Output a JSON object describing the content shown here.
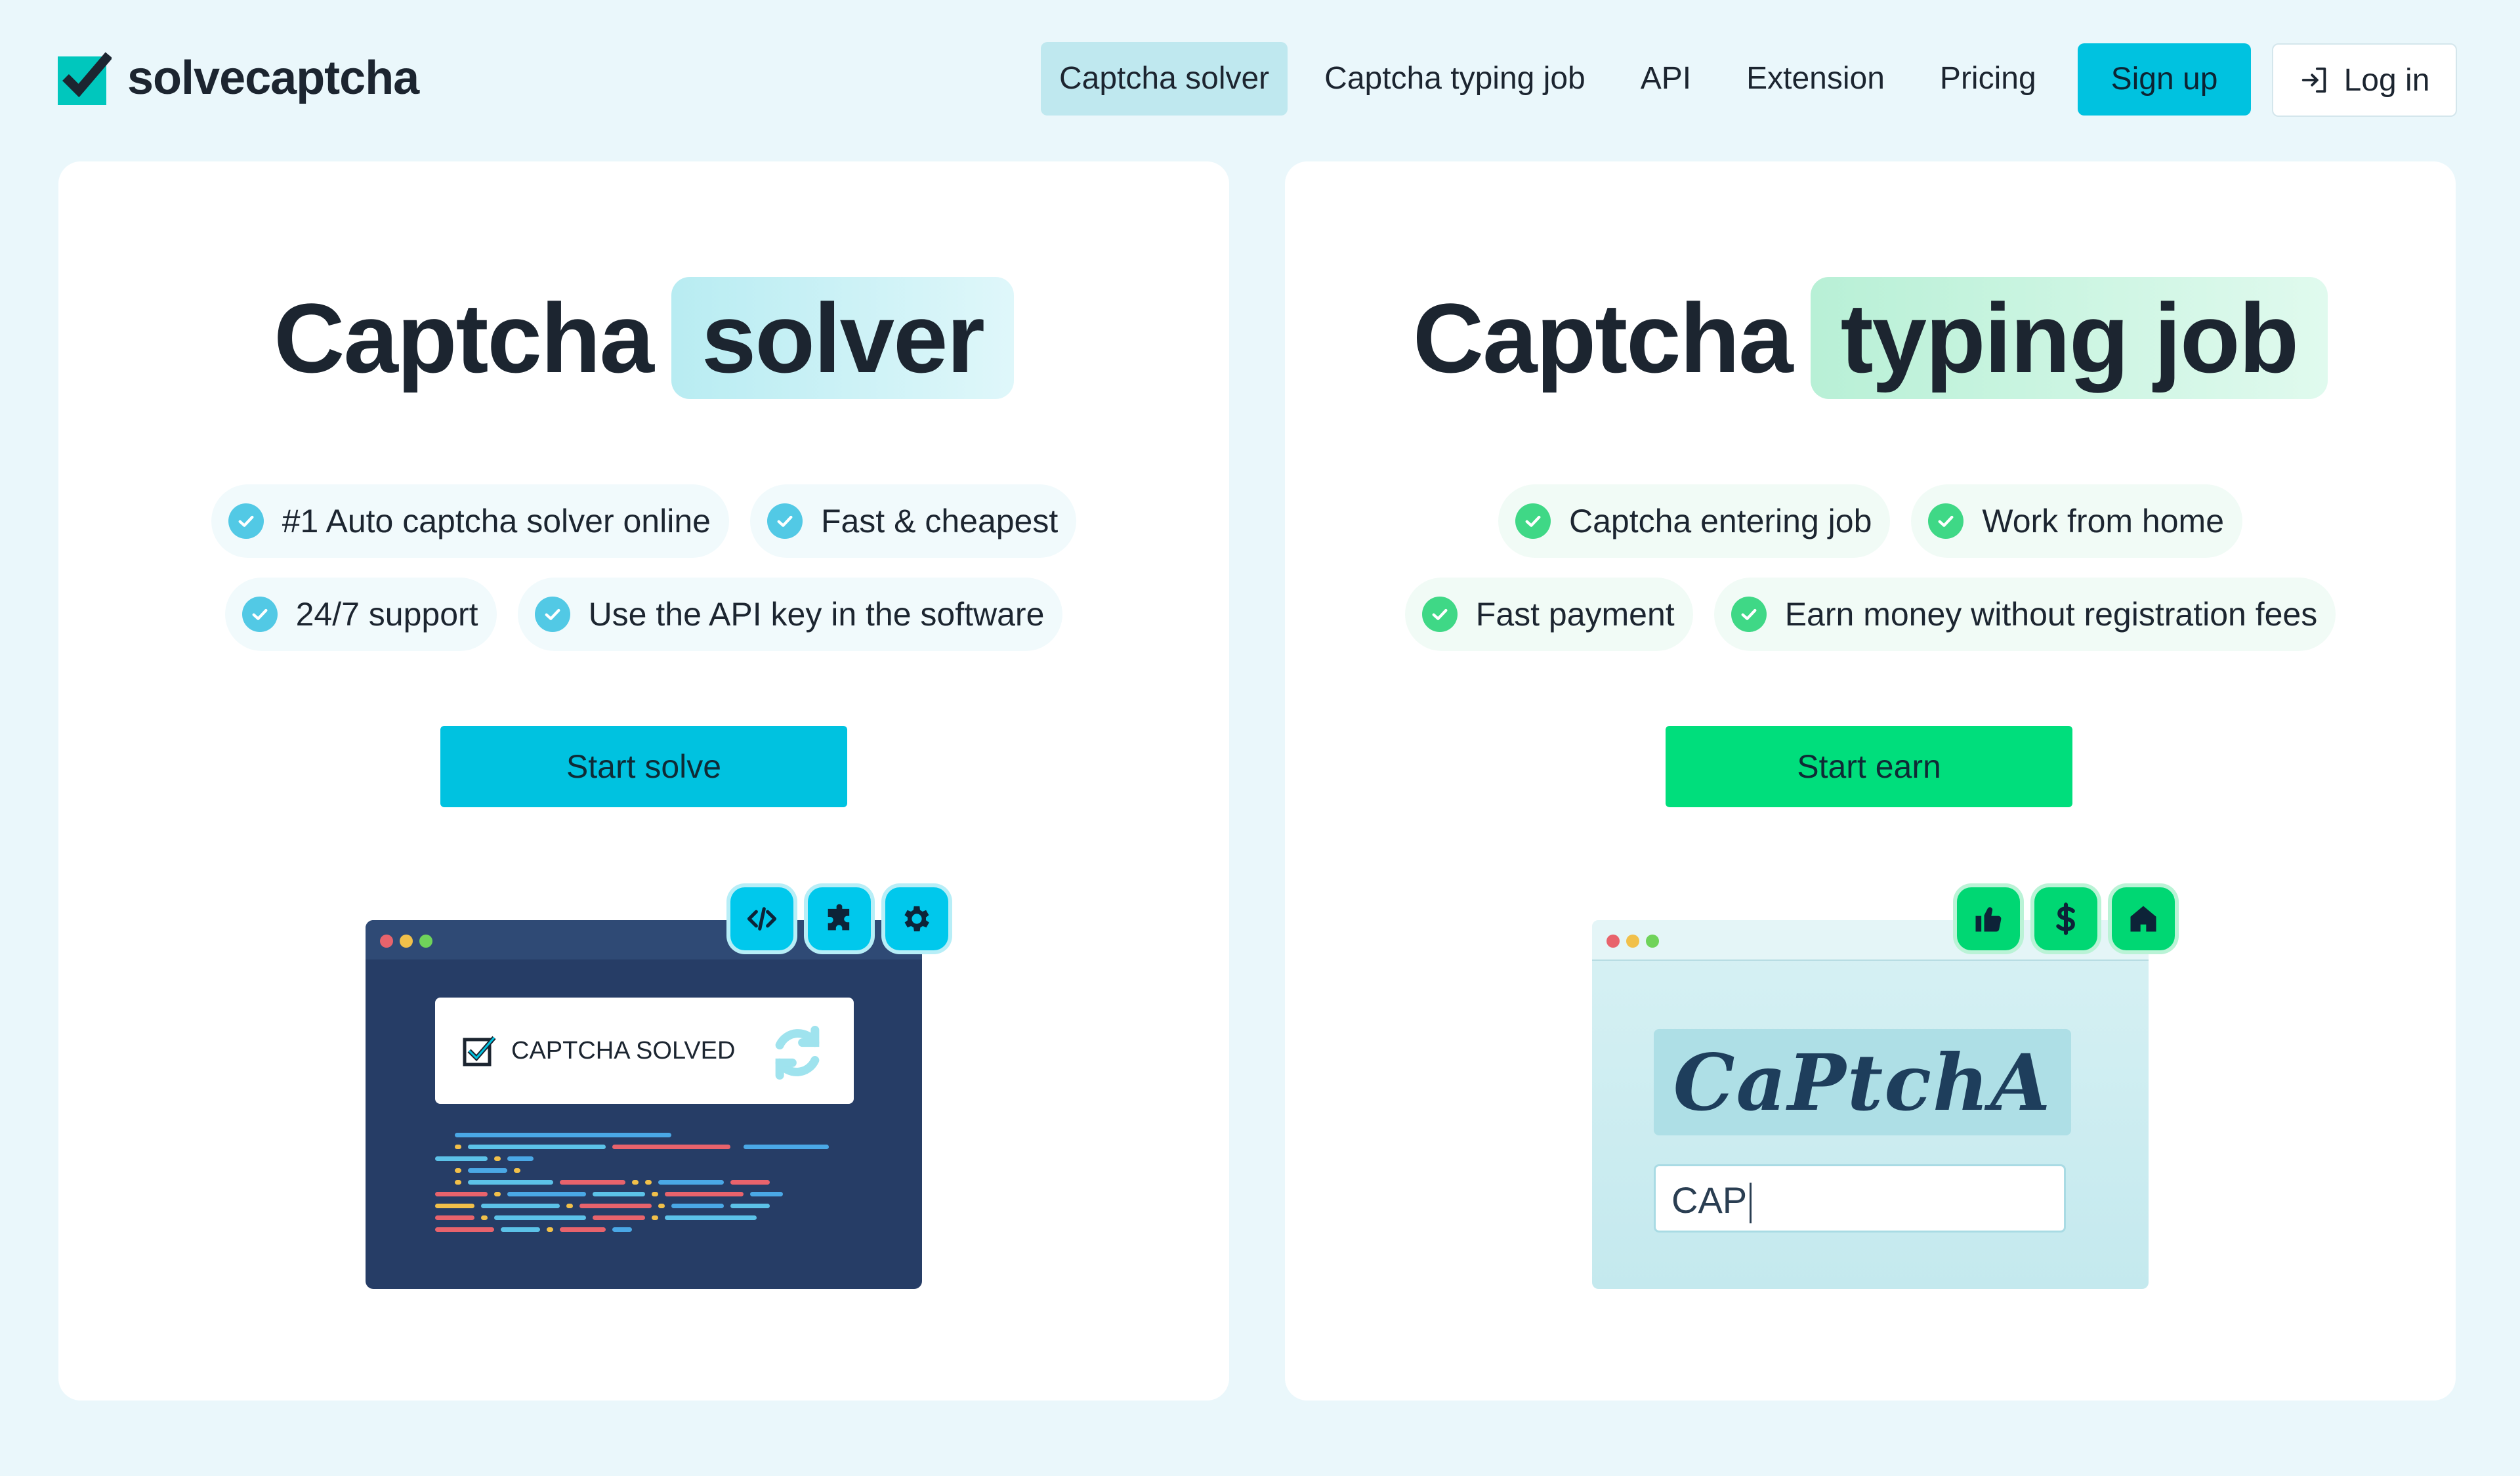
{
  "brand": {
    "name": "solvecaptcha"
  },
  "nav": {
    "items": [
      {
        "label": "Captcha solver",
        "active": true
      },
      {
        "label": "Captcha typing job",
        "active": false
      },
      {
        "label": "API",
        "active": false
      },
      {
        "label": "Extension",
        "active": false
      },
      {
        "label": "Pricing",
        "active": false
      }
    ],
    "signup_label": "Sign up",
    "login_label": "Log in"
  },
  "solver_card": {
    "title_main": "Captcha",
    "title_highlight": "solver",
    "features": [
      "#1 Auto captcha solver online",
      "Fast & cheapest",
      "24/7 support",
      "Use the API key in the software"
    ],
    "cta_label": "Start solve",
    "illustration": {
      "status_text": "CAPTCHA SOLVED",
      "icons": [
        "code-icon",
        "puzzle-icon",
        "gear-icon"
      ]
    }
  },
  "job_card": {
    "title_main": "Captcha",
    "title_highlight": "typing job",
    "features": [
      "Captcha entering job",
      "Work from home",
      "Fast payment",
      "Earn money without registration fees"
    ],
    "cta_label": "Start earn",
    "illustration": {
      "captcha_text": "CaPtchA",
      "input_value": "CAP",
      "icons": [
        "thumbs-up-icon",
        "dollar-icon",
        "home-icon"
      ]
    }
  },
  "colors": {
    "accent_blue": "#00c2e0",
    "accent_green": "#00de7c",
    "background": "#eaf7fb",
    "text": "#1c2530"
  }
}
